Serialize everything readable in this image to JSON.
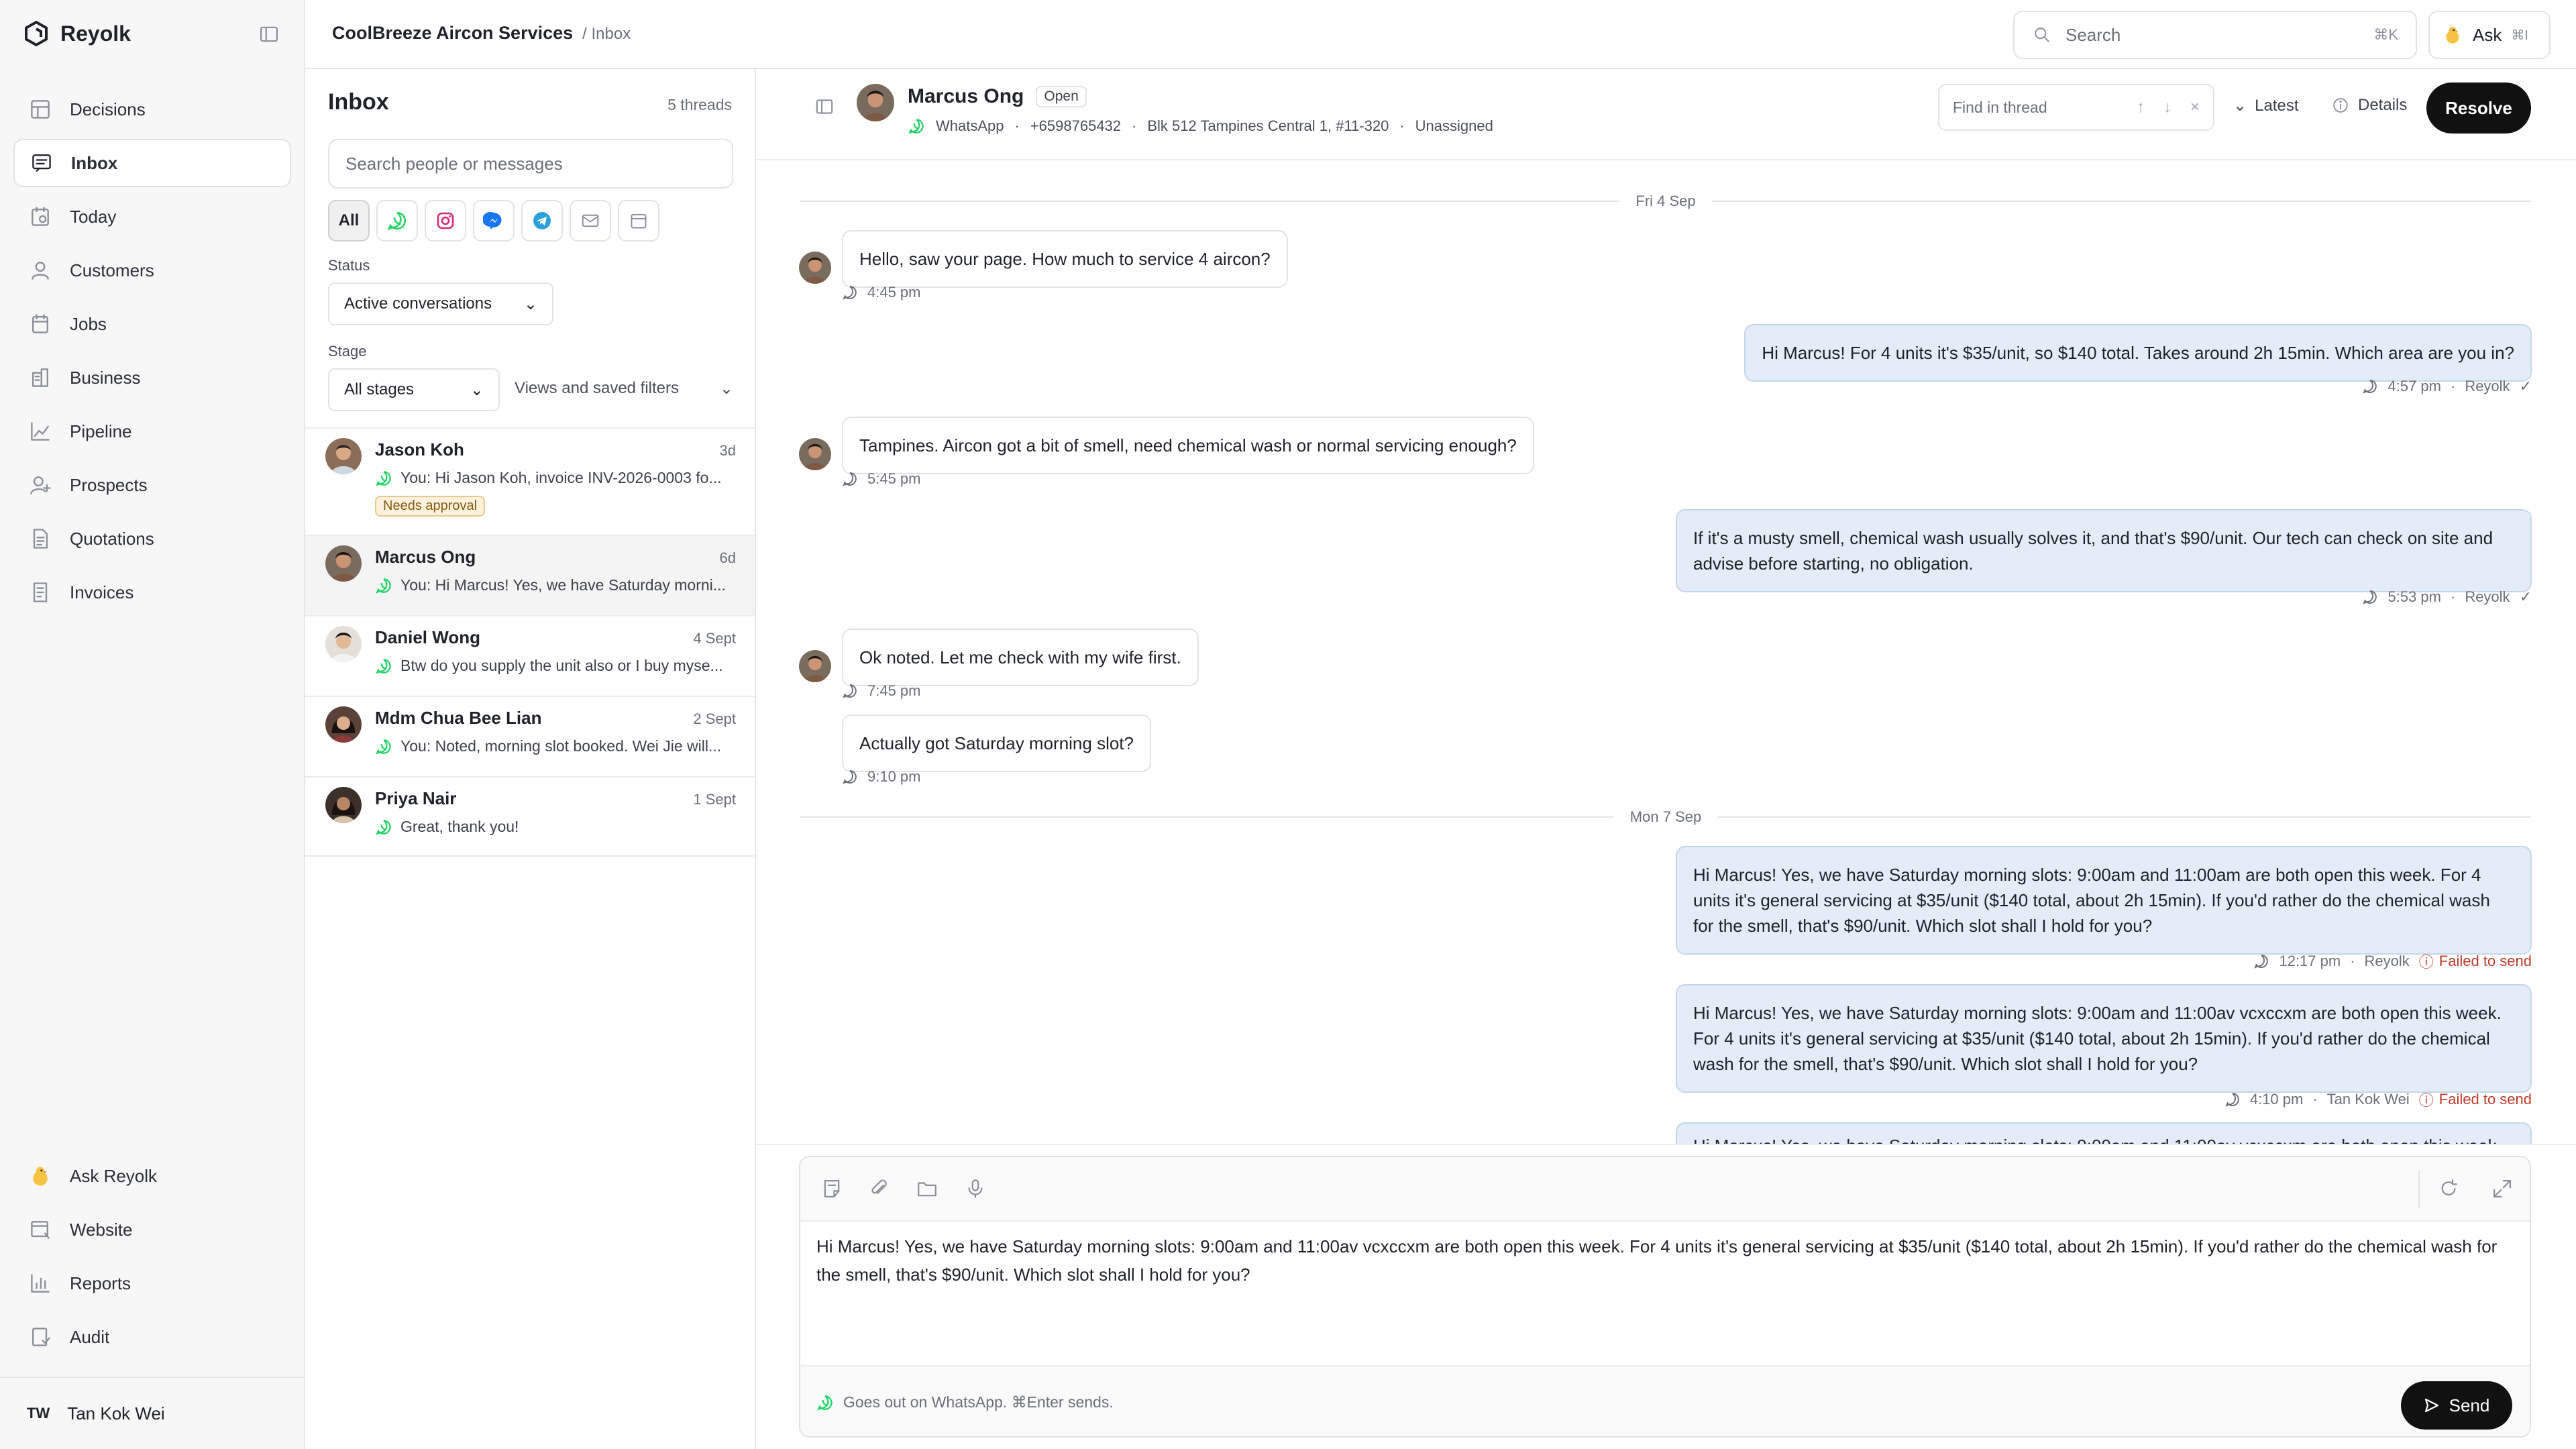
{
  "app": {
    "name": "Reyolk",
    "collapse_icon": "sidebar-toggle-icon"
  },
  "sidebar": {
    "items": [
      {
        "label": "Decisions",
        "icon": "grid-icon"
      },
      {
        "label": "Inbox",
        "icon": "inbox-icon",
        "active": true
      },
      {
        "label": "Today",
        "icon": "calendar-today-icon"
      },
      {
        "label": "Customers",
        "icon": "person-icon"
      },
      {
        "label": "Jobs",
        "icon": "clipboard-icon"
      },
      {
        "label": "Business",
        "icon": "building-icon"
      },
      {
        "label": "Pipeline",
        "icon": "trend-icon"
      },
      {
        "label": "Prospects",
        "icon": "person-add-icon"
      },
      {
        "label": "Quotations",
        "icon": "document-icon"
      },
      {
        "label": "Invoices",
        "icon": "receipt-icon"
      }
    ],
    "bottom_items": [
      {
        "label": "Ask Reyolk",
        "icon": "chick-icon"
      },
      {
        "label": "Website",
        "icon": "globe-icon"
      },
      {
        "label": "Reports",
        "icon": "bar-chart-icon"
      },
      {
        "label": "Audit",
        "icon": "shield-icon"
      }
    ],
    "user": {
      "initials": "TW",
      "name": "Tan Kok Wei"
    }
  },
  "topbar": {
    "company": "CoolBreeze Aircon Services",
    "page": "/ Inbox",
    "search_placeholder": "Search",
    "search_shortcut": "⌘K",
    "ask_label": "Ask",
    "ask_shortcut": "⌘I"
  },
  "inbox": {
    "title": "Inbox",
    "count": "5 threads",
    "search_placeholder": "Search people or messages",
    "channels": [
      "All",
      "whatsapp-icon",
      "instagram-icon",
      "messenger-icon",
      "telegram-icon",
      "mail-icon",
      "calendar-icon"
    ],
    "status_label": "Status",
    "status_value": "Active conversations",
    "stage_label": "Stage",
    "stage_value": "All stages",
    "views_label": "Views and saved filters",
    "threads": [
      {
        "name": "Jason Koh",
        "date": "3d",
        "preview": "You: Hi Jason Koh, invoice INV-2026-0003 fo...",
        "badge": "Needs approval"
      },
      {
        "name": "Marcus Ong",
        "date": "6d",
        "preview": "You: Hi Marcus! Yes, we have Saturday morni...",
        "selected": true
      },
      {
        "name": "Daniel Wong",
        "date": "4 Sept",
        "preview": "Btw do you supply the unit also or I buy myse..."
      },
      {
        "name": "Mdm Chua Bee Lian",
        "date": "2 Sept",
        "preview": "You: Noted, morning slot booked. Wei Jie will..."
      },
      {
        "name": "Priya Nair",
        "date": "1 Sept",
        "preview": "Great, thank you!"
      }
    ]
  },
  "conversation": {
    "contact": "Marcus Ong",
    "status": "Open",
    "channel": "WhatsApp",
    "phone": "+6598765432",
    "address": "Blk 512 Tampines Central 1, #11-320",
    "assignee": "Unassigned",
    "find_placeholder": "Find in thread",
    "latest_label": "Latest",
    "details_label": "Details",
    "resolve_label": "Resolve",
    "days": [
      "Fri 4 Sep",
      "Mon 7 Sep"
    ],
    "messages": [
      {
        "dir": "in",
        "text": "Hello, saw your page. How much to service 4 aircon?",
        "time": "4:45 pm"
      },
      {
        "dir": "out",
        "text": "Hi Marcus! For 4 units it's $35/unit, so $140 total. Takes around 2h 15min. Which area are you in?",
        "time": "4:57 pm",
        "by": "Reyolk"
      },
      {
        "dir": "in",
        "text": "Tampines. Aircon got a bit of smell, need chemical wash or normal servicing enough?",
        "time": "5:45 pm"
      },
      {
        "dir": "out",
        "text": "If it's a musty smell, chemical wash usually solves it, and that's $90/unit. Our tech can check on site and advise before starting, no obligation.",
        "time": "5:53 pm",
        "by": "Reyolk"
      },
      {
        "dir": "in",
        "text": "Ok noted. Let me check with my wife first.",
        "time": "7:45 pm"
      },
      {
        "dir": "in",
        "text": "Actually got Saturday morning slot?",
        "time": "9:10 pm"
      },
      {
        "dir": "out",
        "text": "Hi Marcus! Yes, we have Saturday morning slots: 9:00am and 11:00am are both open this week. For 4 units it's general servicing at $35/unit ($140 total, about 2h 15min). If you'd rather do the chemical wash for the smell, that's $90/unit. Which slot shall I hold for you?",
        "time": "12:17 pm",
        "by": "Reyolk",
        "status": "Failed to send"
      },
      {
        "dir": "out",
        "text": "Hi Marcus! Yes, we have Saturday morning slots: 9:00am and 11:00av vcxccxm are both open this week. For 4 units it's general servicing at $35/unit ($140 total, about 2h 15min). If you'd rather do the chemical wash for the smell, that's $90/unit. Which slot shall I hold for you?",
        "time": "4:10 pm",
        "by": "Tan Kok Wei",
        "status": "Failed to send"
      },
      {
        "dir": "out",
        "text": "Hi Marcus! Yes, we have Saturday morning slots: 9:00am and 11:00av vcxccxm are both open this week.",
        "partial": true
      }
    ]
  },
  "composer": {
    "text": "Hi Marcus! Yes, we have Saturday morning slots: 9:00am and 11:00av vcxccxm are both open this week. For 4 units it's general servicing at $35/unit ($140 total, about 2h 15min). If you'd rather do the chemical wash for the smell, that's $90/unit. Which slot shall I hold for you?",
    "hint": "Goes out on WhatsApp. ⌘Enter sends.",
    "send_label": "Send"
  },
  "colors": {
    "accent_dark": "#111111",
    "whatsapp": "#25D366",
    "outgoing_bubble": "#e3ecf7",
    "error": "#c0392b",
    "badge_bg": "#fbf1dc"
  }
}
